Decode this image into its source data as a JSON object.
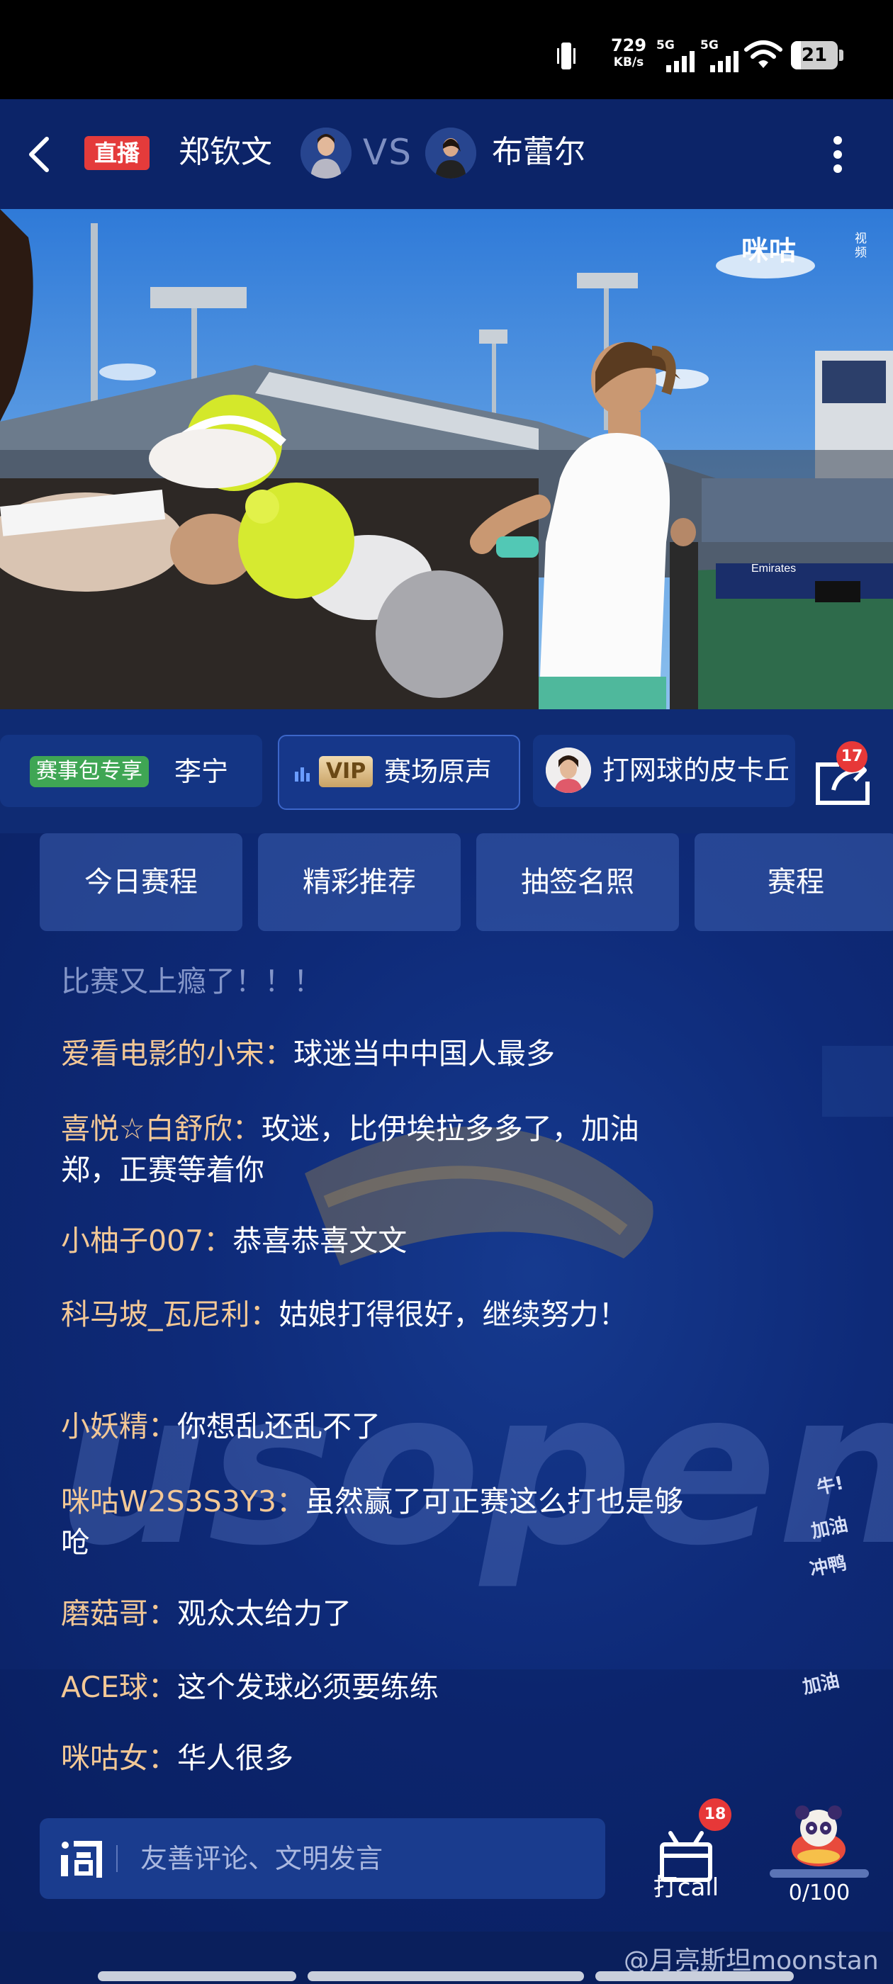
{
  "status_bar": {
    "net_speed_value": "729",
    "net_speed_unit": "KB/s",
    "signal1_label": "5G",
    "signal2_label": "5G",
    "battery_level": "21",
    "icons": [
      "vibrate-icon",
      "signal-icon",
      "wifi-icon",
      "battery-icon"
    ]
  },
  "header": {
    "live_badge": "直播",
    "player1": "郑钦文",
    "vs": "VS",
    "player2": "布蕾尔",
    "icons": [
      "back-arrow-icon",
      "more-vertical-icon"
    ]
  },
  "video": {
    "logo_text": "咪咕",
    "logo_sub": "视频",
    "scoreboard_text": "Emirates"
  },
  "tab_row": {
    "pill1_tag": "赛事包专享",
    "pill1_label": "李宁",
    "pill2_badge": "VIP",
    "pill2_label": "赛场原声",
    "pill3_label": "打网球的皮卡丘",
    "share_badge": "17"
  },
  "quick_buttons": [
    {
      "label": "今日赛程"
    },
    {
      "label": "精彩推荐"
    },
    {
      "label": "抽签名照"
    },
    {
      "label": "赛程"
    }
  ],
  "chat": {
    "faded_line": "比赛又上瘾了！！！",
    "messages": [
      {
        "user": "爱看电影的小宋：",
        "text": "球迷当中中国人最多"
      },
      {
        "user": "喜悦☆白舒欣：",
        "text": "玫迷，比伊埃拉多多了，加油郑，正赛等着你"
      },
      {
        "user": "小柚子007：",
        "text": "恭喜恭喜文文"
      },
      {
        "user": "科马坡_瓦尼利：",
        "text": "姑娘打得很好，继续努力！"
      },
      {
        "user": "小妖精：",
        "text": "你想乱还乱不了"
      },
      {
        "user": "咪咕W2S3S3Y3：",
        "text": "虽然赢了可正赛这么打也是够呛"
      },
      {
        "user": "磨菇哥：",
        "text": "观众太给力了"
      },
      {
        "user": "ACE球：",
        "text": "这个发球必须要练练"
      },
      {
        "user": "咪咕女：",
        "text": "华人很多"
      }
    ],
    "floating_emotes": [
      "牛!",
      "加油",
      "冲鸭",
      "加油"
    ],
    "background_logo": "usopen"
  },
  "bottom": {
    "input_placeholder": "友善评论、文明发言",
    "call_label": "打call",
    "call_badge": "18",
    "progress_text": "0/100",
    "progress_fraction": 0.0
  },
  "footer": {
    "weibo_watermark": "@月亮斯坦moonstan"
  },
  "colors": {
    "page_bg": "#0d2470",
    "live_red": "#e43b3b",
    "username": "#f3c896",
    "vip_gold": "#d8b87a",
    "tag_green": "#3fa654"
  }
}
